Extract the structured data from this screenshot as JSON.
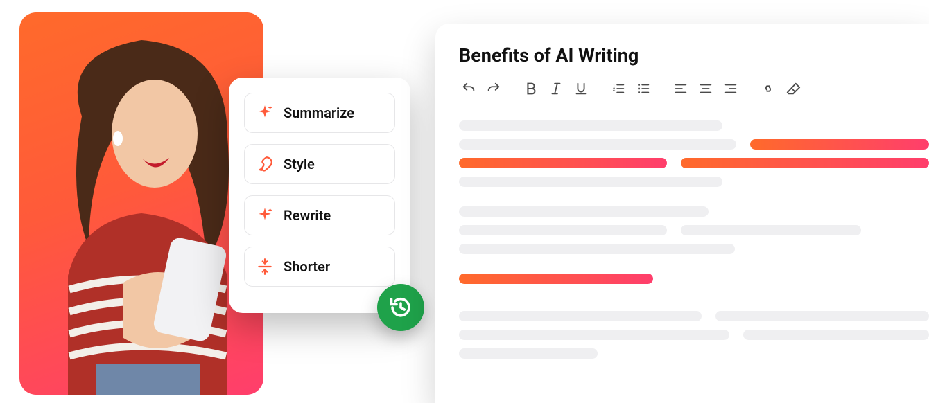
{
  "ai_menu": {
    "items": [
      {
        "label": "Summarize",
        "icon": "sparkle-icon"
      },
      {
        "label": "Style",
        "icon": "brush-icon"
      },
      {
        "label": "Rewrite",
        "icon": "sparkle-icon"
      },
      {
        "label": "Shorter",
        "icon": "collapse-icon"
      }
    ]
  },
  "history_badge": {
    "icon": "history-icon"
  },
  "editor": {
    "title": "Benefits of AI Writing",
    "toolbar": {
      "undo": "undo-icon",
      "redo": "redo-icon",
      "bold": "bold-icon",
      "italic": "italic-icon",
      "underline": "underline-icon",
      "ordered_list": "ordered-list-icon",
      "bullet_list": "bullet-list-icon",
      "align_left": "align-left-icon",
      "align_center": "align-center-icon",
      "align_right": "align-right-icon",
      "link": "link-icon",
      "erase": "erase-icon"
    }
  },
  "colors": {
    "accent_gradient_start": "#ff6a2b",
    "accent_gradient_end": "#ff3e6c",
    "badge_green": "#1fa24a"
  }
}
